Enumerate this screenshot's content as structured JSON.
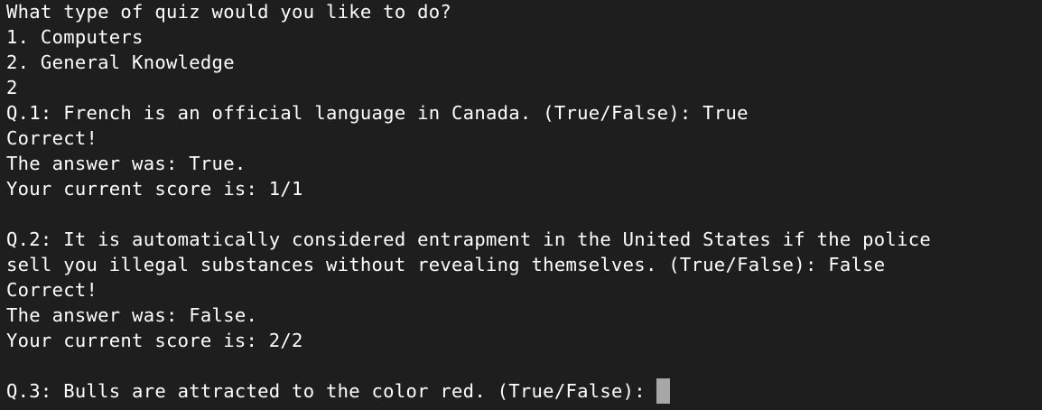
{
  "terminal": {
    "lines": [
      "What type of quiz would you like to do?",
      "1. Computers",
      "2. General Knowledge",
      "2",
      "Q.1: French is an official language in Canada. (True/False): True",
      "Correct!",
      "The answer was: True.",
      "Your current score is: 1/1",
      "",
      "Q.2: It is automatically considered entrapment in the United States if the police",
      "sell you illegal substances without revealing themselves. (True/False): False",
      "Correct!",
      "The answer was: False.",
      "Your current score is: 2/2",
      "",
      "Q.3: Bulls are attracted to the color red. (True/False):"
    ],
    "colors": {
      "background": "#1e1e1e",
      "text": "#ffffff",
      "cursor": "#a7a7a7"
    }
  }
}
